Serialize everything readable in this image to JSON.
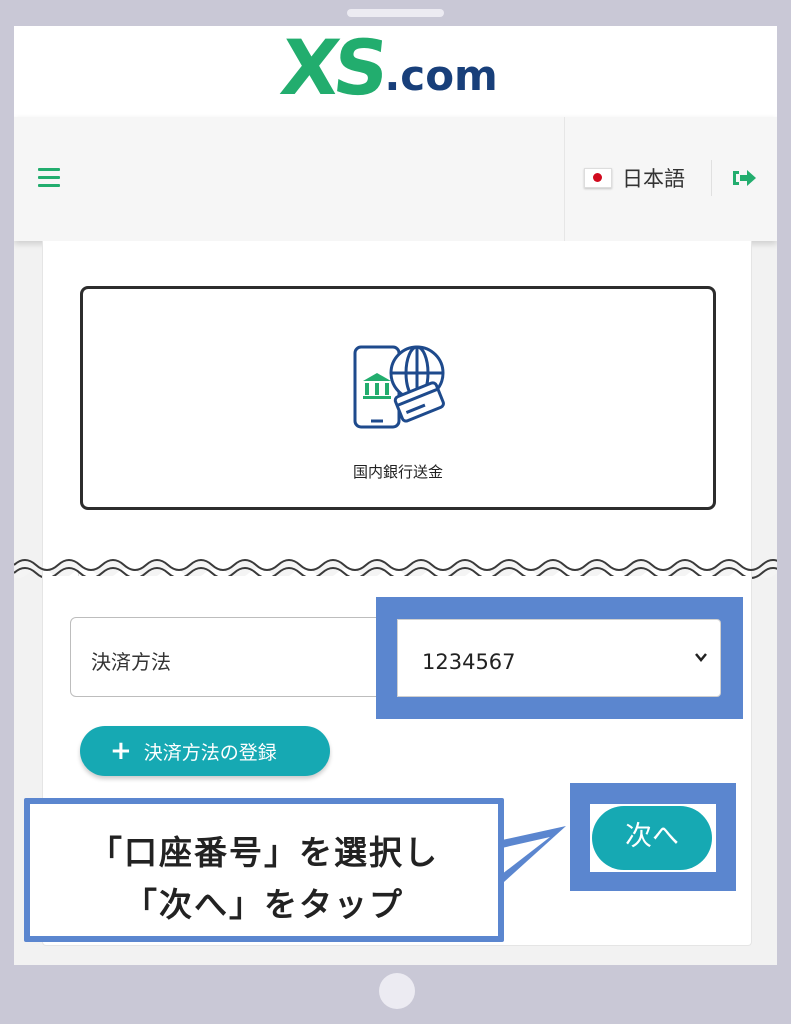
{
  "header": {
    "logo_main": "XS",
    "logo_suffix": ".com",
    "language_label": "日本語",
    "icons": {
      "menu": "hamburger-icon",
      "flag": "japan-flag-icon",
      "logout": "sign-out-icon"
    }
  },
  "deposit": {
    "method_card_label": "国内銀行送金",
    "method_card_icon": "bank-transfer-icon",
    "payment_method_label": "決済方法",
    "payment_method_value": "1234567",
    "add_method_label": "決済方法の登録",
    "next_label": "次へ"
  },
  "annotation": {
    "line1": "「口座番号」を選択し",
    "line2": "「次へ」をタップ"
  },
  "colors": {
    "brand_green": "#22ad6e",
    "brand_navy": "#183f7a",
    "button_teal": "#16a9b3",
    "highlight_blue": "#5b86cf"
  }
}
